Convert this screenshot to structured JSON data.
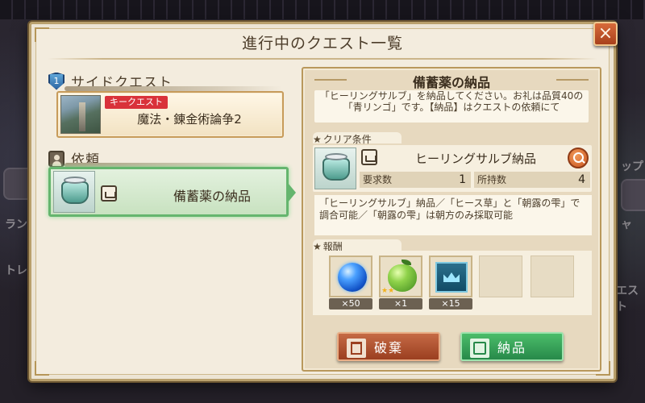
{
  "dialog": {
    "title": "進行中のクエスト一覧",
    "close_label": "×"
  },
  "side_quest": {
    "heading": "サイドクエスト",
    "badge_text": "1",
    "card": {
      "tag": "キークエスト",
      "name": "魔法・錬金術論争2"
    }
  },
  "requests": {
    "heading": "依頼",
    "items": [
      {
        "name": "備蓄薬の納品"
      }
    ]
  },
  "detail": {
    "title": "備蓄薬の納品",
    "description": "「ヒーリングサルブ」を納品してください。お礼は品質40の「青リンゴ」です。【納品】はクエストの依頼にて",
    "clear_condition": {
      "heading": "クリア条件",
      "item_name": "ヒーリングサルブ納品",
      "required_label": "要求数",
      "required_value": "1",
      "owned_label": "所持数",
      "owned_value": "4"
    },
    "hint": "「ヒーリングサルブ」納品／「ヒース草」と「朝露の雫」で調合可能／「朝露の雫」は朝方のみ採取可能",
    "rewards": {
      "heading": "報酬",
      "items": [
        {
          "icon": "blue-orb-icon",
          "qty": "×50"
        },
        {
          "icon": "green-apple-icon",
          "qty": "×1",
          "stars": "★★"
        },
        {
          "icon": "crown-tile-icon",
          "qty": "×15"
        }
      ]
    },
    "buttons": {
      "discard": "破棄",
      "deliver": "納品"
    }
  },
  "background": {
    "labels": [
      "ラン",
      "トレ",
      "ャ",
      "エスト",
      "ップ"
    ]
  },
  "colors": {
    "accent_green": "#65b56e",
    "key_quest_red": "#d9323a",
    "discard_red": "#9b3f20",
    "deliver_green": "#27894a"
  }
}
